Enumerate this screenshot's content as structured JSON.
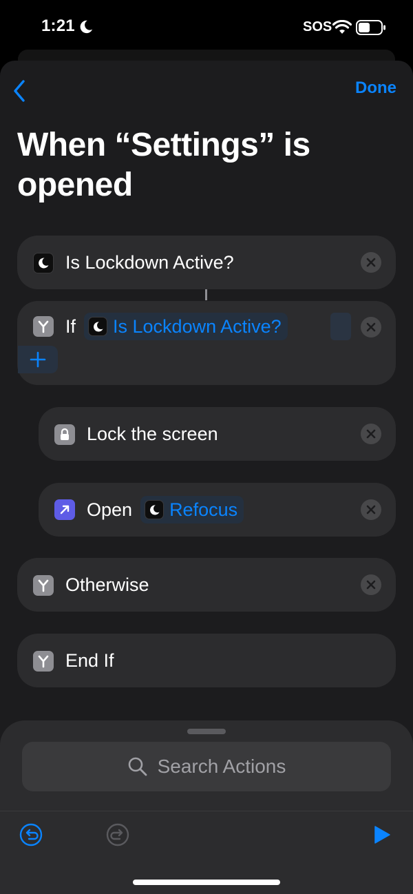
{
  "status_bar": {
    "time": "1:21",
    "carrier_text": "SOS"
  },
  "nav": {
    "done_label": "Done"
  },
  "page": {
    "title": "When “Settings” is opened"
  },
  "actions": [
    {
      "label": "Is Lockdown Active?",
      "icon": "moon-icon"
    },
    {
      "label": "If",
      "icon": "branch-icon",
      "token": "Is Lockdown Active?",
      "token_icon": "moon-icon"
    },
    {
      "label": "Lock the screen",
      "icon": "lock-icon"
    },
    {
      "label": "Open",
      "icon": "arrow-up-right-icon",
      "token": "Refocus",
      "token_icon": "moon-icon"
    },
    {
      "label": "Otherwise",
      "icon": "branch-icon"
    },
    {
      "label": "End If",
      "icon": "branch-icon"
    }
  ],
  "search": {
    "placeholder": "Search Actions"
  },
  "colors": {
    "accent": "#0a84ff",
    "background": "#1c1c1e",
    "card": "#2c2c2e",
    "open_app_tile": "#5e5ce6"
  }
}
